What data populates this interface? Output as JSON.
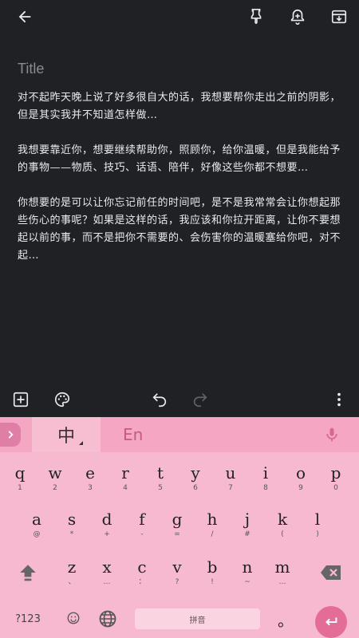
{
  "toolbar": {
    "back_icon": "arrow-back-icon",
    "pin_icon": "pin-icon",
    "reminder_icon": "bell-plus-icon",
    "archive_icon": "archive-icon"
  },
  "note": {
    "title_placeholder": "Title",
    "paragraphs": [
      "对不起昨天晚上说了好多很自大的话，我想要帮你走出之前的阴影，但是其实我并不知道怎样做…",
      "我想要靠近你，想要继续帮助你，照顾你，给你温暖，但是我能给予的事物——物质、技巧、话语、陪伴，好像这些你都不想要…",
      "你想要的是可以让你忘记前任的时间吧，是不是我常常会让你想起那些伤心的事呢？如果是这样的话，我应该和你拉开距离，让你不要想起以前的事，而不是把你不需要的、会伤害你的温暖塞给你吧，对不起…"
    ]
  },
  "note_toolbar": {
    "add_icon": "add-box-icon",
    "palette_icon": "palette-icon",
    "undo_icon": "undo-icon",
    "redo_icon": "redo-icon",
    "more_icon": "more-vert-icon"
  },
  "keyboard": {
    "tabs": {
      "chinese": "中",
      "english": "En"
    },
    "row1": [
      {
        "k": "q",
        "s": "1"
      },
      {
        "k": "w",
        "s": "2"
      },
      {
        "k": "e",
        "s": "3"
      },
      {
        "k": "r",
        "s": "4"
      },
      {
        "k": "t",
        "s": "5"
      },
      {
        "k": "y",
        "s": "6"
      },
      {
        "k": "u",
        "s": "7"
      },
      {
        "k": "i",
        "s": "8"
      },
      {
        "k": "o",
        "s": "9"
      },
      {
        "k": "p",
        "s": "0"
      }
    ],
    "row2": [
      {
        "k": "a",
        "s": "@"
      },
      {
        "k": "s",
        "s": "*"
      },
      {
        "k": "d",
        "s": "+"
      },
      {
        "k": "f",
        "s": "-"
      },
      {
        "k": "g",
        "s": "="
      },
      {
        "k": "h",
        "s": "/"
      },
      {
        "k": "j",
        "s": "#"
      },
      {
        "k": "k",
        "s": "("
      },
      {
        "k": "l",
        "s": ")"
      }
    ],
    "row3": [
      {
        "k": "z",
        "s": "、"
      },
      {
        "k": "x",
        "s": "…"
      },
      {
        "k": "c",
        "s": "："
      },
      {
        "k": "v",
        "s": "?"
      },
      {
        "k": "b",
        "s": "!"
      },
      {
        "k": "n",
        "s": "~"
      },
      {
        "k": "m",
        "s": "…"
      }
    ],
    "symbols_label": "?123",
    "space_label": "拼音",
    "period_label": "。",
    "colors": {
      "panel": "#f7b9cf",
      "top_bar": "#f4a6c2",
      "accent": "#e46d97",
      "en_tab": "#c55a86"
    }
  }
}
